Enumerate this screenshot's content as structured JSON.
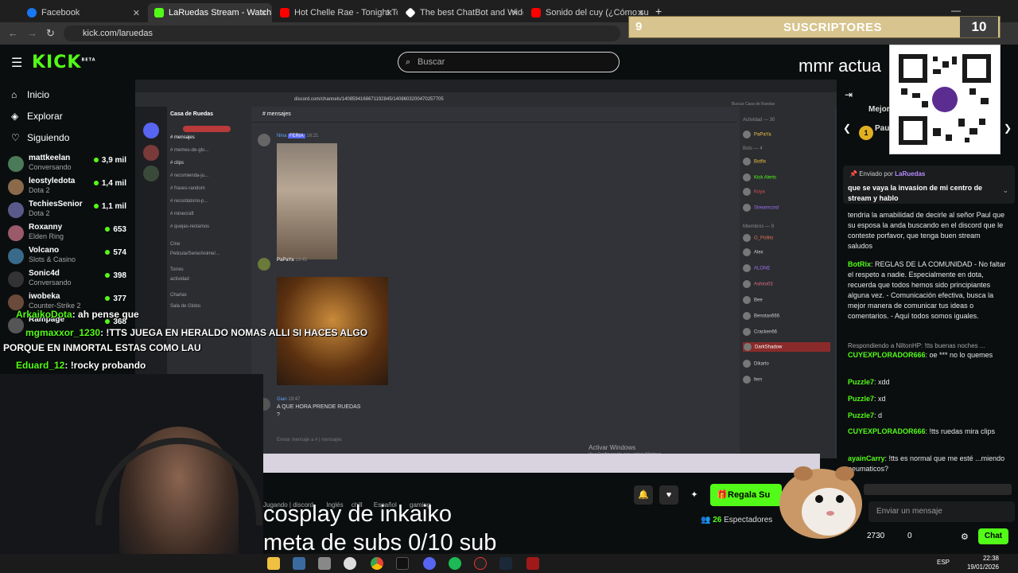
{
  "browser": {
    "tabs": [
      {
        "title": "Facebook",
        "color": "#1877f2"
      },
      {
        "title": "LaRuedas Stream - Watch Live",
        "color": "#53fc18"
      },
      {
        "title": "Hot Chelle Rae - Tonight To",
        "color": "#ff0000"
      },
      {
        "title": "The best ChatBot and Widgets",
        "color": "#ffffff"
      },
      {
        "title": "Sonido del cuy (¿Cómo suenan",
        "color": "#ff0000"
      }
    ],
    "url": "kick.com/laruedas"
  },
  "kick": {
    "logo": "KICK",
    "logo_badge": "BETA",
    "search_placeholder": "Buscar",
    "nav": [
      {
        "label": "Inicio",
        "icon": "home-icon"
      },
      {
        "label": "Explorar",
        "icon": "compass-icon"
      },
      {
        "label": "Siguiendo",
        "icon": "heart-icon"
      }
    ],
    "channels": [
      {
        "name": "mattkeelan",
        "game": "Conversando",
        "viewers": "3,9 mil"
      },
      {
        "name": "leostyledota",
        "game": "Dota 2",
        "viewers": "1,4 mil"
      },
      {
        "name": "TechiesSenior",
        "game": "Dota 2",
        "viewers": "1,1 mil"
      },
      {
        "name": "Roxanny",
        "game": "Elden Ring",
        "viewers": "653"
      },
      {
        "name": "Volcano",
        "game": "Slots & Casino",
        "viewers": "574"
      },
      {
        "name": "Sonic4d",
        "game": "Conversando",
        "viewers": "398"
      },
      {
        "name": "iwobeka",
        "game": "Counter-Strike 2",
        "viewers": "377"
      },
      {
        "name": "Rampage",
        "game": "",
        "viewers": "368"
      }
    ]
  },
  "overlay": {
    "subs_left": "9",
    "subs_title": "SUSCRIPTORES",
    "subs_right": "10",
    "mmr": "mmr actua",
    "chat_lines": [
      {
        "user": "ArkaikoDota",
        "text": ": ah pense que"
      },
      {
        "user": "mgmaxxor_1230",
        "text": ": !TTS JUEGA EN HERALDO NOMAS ALLI SI HACES ALGO"
      },
      {
        "user": "",
        "text": "PORQUE EN INMORTAL ESTAS COMO LAU"
      },
      {
        "user": "Eduard_12",
        "text": ": !rocky probando"
      }
    ],
    "big_line1": "cosplay de inkaiko",
    "big_line2": "meta de subs  0/10 sub"
  },
  "discord": {
    "server": "Casa de Ruedas",
    "channel": "mensajes",
    "search": "Buscar Casa de Ruedas",
    "url": "discord.com/channels/1408594168671192845/1408603200470257705",
    "channels": [
      "mensajes",
      "memes-de-glo...",
      "clips",
      "recomienda-ju...",
      "frases-random",
      "recordatorio-p...",
      "minecraft",
      "quejas-reclamos"
    ],
    "categories": [
      "Cine",
      "Pelicula/Serie/Anime/...",
      "Torres",
      "actividad",
      "Charlas",
      "Sala de Globo"
    ],
    "messages": [
      {
        "user": "Nina",
        "tag": "FERIA",
        "time": "16:21"
      },
      {
        "user": "PaPaYa",
        "time": "19:45"
      },
      {
        "user": "Gian",
        "time": "19:47",
        "text": "A QUE HORA PRENDE RUEDAS",
        "text2": "?"
      }
    ],
    "composer": "Enviar mensaje a # | mensajes",
    "members_header": "Actividad — 30",
    "members": [
      "PaPaYa",
      "Bots — 4",
      "Botfix",
      "Kick Alerts",
      "Koya",
      "Streamcord",
      "Miembros — 9",
      "O_Pollito",
      "Alex",
      "ALONE",
      "Ashiro03",
      "Bee",
      "Benotas666",
      "Cracken66",
      "DarkShadow",
      "Dikarlo",
      "fern"
    ],
    "activate_windows_1": "Activar Windows",
    "activate_windows_2": "Ve a Configuración para activar Windows."
  },
  "chat": {
    "header": "Mejor",
    "top_user": "Paul",
    "pinned_by": "Enviado por",
    "pinned_user": "LaRuedas",
    "pinned_text": "que se vaya la invasion de mi centro de stream y hablo",
    "messages": [
      {
        "user": "",
        "text": "tendria la amabilidad de decirle al señor Paul que su esposa la anda buscando en el discord que le conteste porfavor, que tenga buen stream saludos",
        "color": "#e8e8e8"
      },
      {
        "user": "BotRix",
        "text": ": REGLAS DE LA COMUNIDAD - No faltar el respeto a nadie. Especialmente en dota, recuerda que todos hemos sido principiantes alguna vez. - Comunicación efectiva, busca la mejor manera de comunicar tus ideas o comentarios. - Aquí todos somos iguales.",
        "color": "#53fc18"
      },
      {
        "user": "",
        "text": "Respondiendo a NiltonHP: !tts buenas noches ...",
        "color": "#a5a5a5"
      },
      {
        "user": "CUYEXPLORADOR666",
        "text": ": oe *** no lo quemes",
        "color": "#e8e8e8"
      },
      {
        "user": "Puzzle7",
        "text": ": xdd",
        "color": "#e8e8e8"
      },
      {
        "user": "Puzzle7",
        "text": ": xd",
        "color": "#e8e8e8"
      },
      {
        "user": "Puzzle7",
        "text": ": d",
        "color": "#e8e8e8"
      },
      {
        "user": "CUYEXPLORADOR666",
        "text": ": !tts ruedas mira clips",
        "color": "#e8e8e8"
      },
      {
        "user": "ayainCarry",
        "text": ": !tts es normal que me esté ...miendo neumaticos?",
        "color": "#e8e8e8"
      }
    ],
    "input_placeholder": "Enviar un mensaje",
    "points": "2730",
    "count": "0",
    "chat_button": "Chat"
  },
  "stream_bar": {
    "gift_button": "Regala Su",
    "viewers": "26",
    "viewers_label": "Espectadores",
    "tags": [
      "Jugando | discord",
      "Inglés",
      "chill",
      "Español",
      "gaming"
    ]
  },
  "taskbar": {
    "lang": "ESP",
    "time": "22:38",
    "date": "19/01/2026"
  },
  "colors": {
    "accent": "#53fc18",
    "bg": "#0b0e0f",
    "discord": "#313338",
    "subs_bar": "#d8c48e"
  }
}
